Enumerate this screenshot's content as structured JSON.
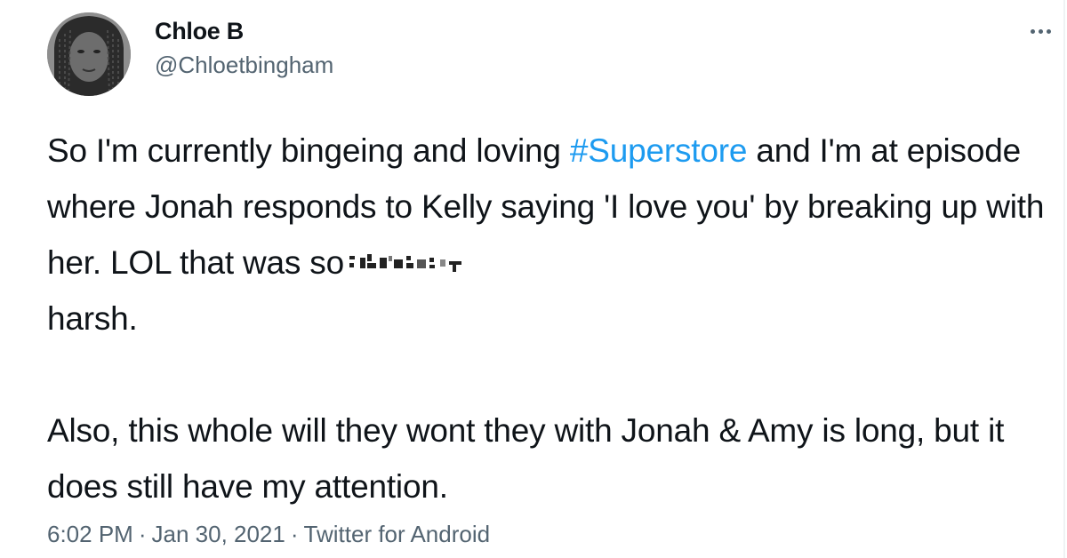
{
  "author": {
    "name": "Chloe B",
    "handle": "@Chloetbingham"
  },
  "tweet": {
    "p1_before": "So I'm currently bingeing and loving ",
    "hashtag": "#Superstore",
    "p1_mid": " and I'm at episode where Jonah responds to Kelly saying 'I love you' by breaking up with her. LOL that was so",
    "p1_end": "harsh.",
    "p2": "Also, this whole will they wont they with Jonah & Amy is long, but it does still have my attention."
  },
  "meta": {
    "time": "6:02 PM",
    "separator": "·",
    "date": "Jan 30, 2021",
    "source": "Twitter for Android"
  },
  "icons": {
    "more": "more-horizontal-icon",
    "censor": "pixelated-censor-block"
  },
  "colors": {
    "text": "#0f1419",
    "secondary": "#536471",
    "hashtag": "#1d9bf0"
  }
}
